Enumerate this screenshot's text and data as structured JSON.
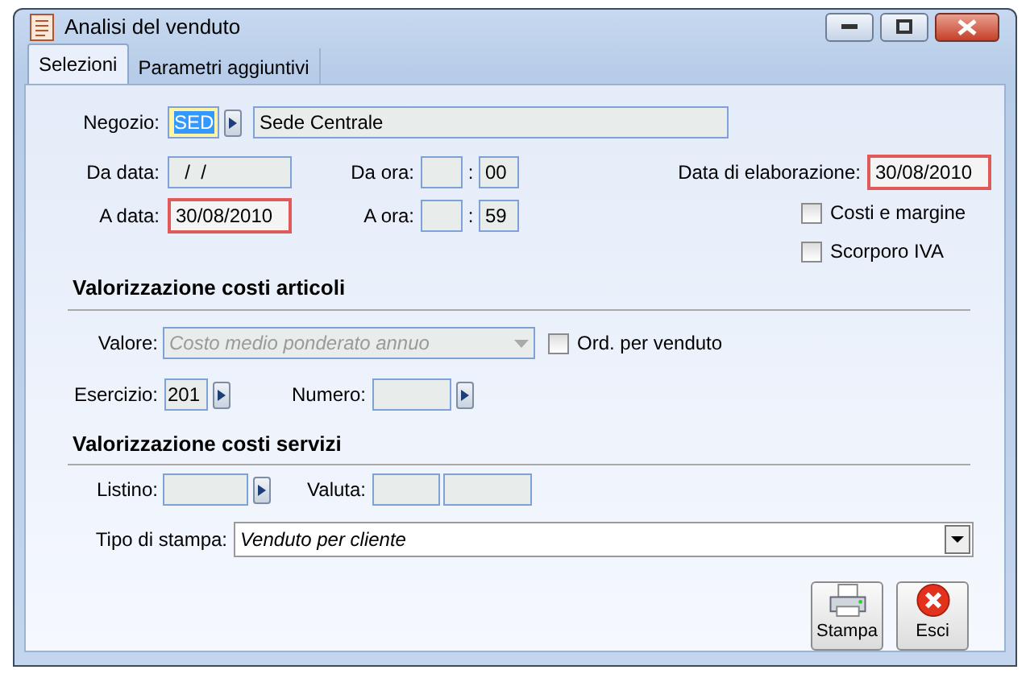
{
  "window": {
    "title": "Analisi del venduto"
  },
  "tabs": [
    {
      "label": "Selezioni",
      "selected": true
    },
    {
      "label": "Parametri aggiuntivi",
      "selected": false
    }
  ],
  "negozio": {
    "label": "Negozio:",
    "code": "SED",
    "code_selected": true,
    "description": "Sede Centrale"
  },
  "date_range": [
    {
      "label": "Da data:",
      "value": "  /  /",
      "highlighted": false,
      "time_label": "Da ora:",
      "time_separator": ":",
      "minute": "00"
    },
    {
      "label": "A data:",
      "value": "30/08/2010",
      "highlighted": true,
      "time_label": "A ora:",
      "time_separator": ":",
      "minute": "59"
    }
  ],
  "data_elaborazione": {
    "label": "Data di elaborazione:",
    "value": "30/08/2010",
    "highlighted": true
  },
  "options": [
    {
      "label": "Costi e margine",
      "checked": false
    },
    {
      "label": "Scorporo IVA",
      "checked": false
    }
  ],
  "section_articoli": {
    "title": "Valorizzazione costi articoli",
    "valore_label": "Valore:",
    "valore": "Costo medio ponderato annuo",
    "valore_disabled": true,
    "ord_label": "Ord. per venduto",
    "ord_checked": false,
    "esercizio_label": "Esercizio:",
    "esercizio": "201",
    "numero_label": "Numero:"
  },
  "section_servizi": {
    "title": "Valorizzazione costi servizi",
    "listino_label": "Listino:",
    "valuta_label": "Valuta:"
  },
  "tipo_stampa": {
    "label": "Tipo di stampa:",
    "value": "Venduto per cliente"
  },
  "buttons": [
    {
      "kind": "print",
      "label": "Stampa"
    },
    {
      "kind": "exit",
      "label": "Esci"
    }
  ]
}
